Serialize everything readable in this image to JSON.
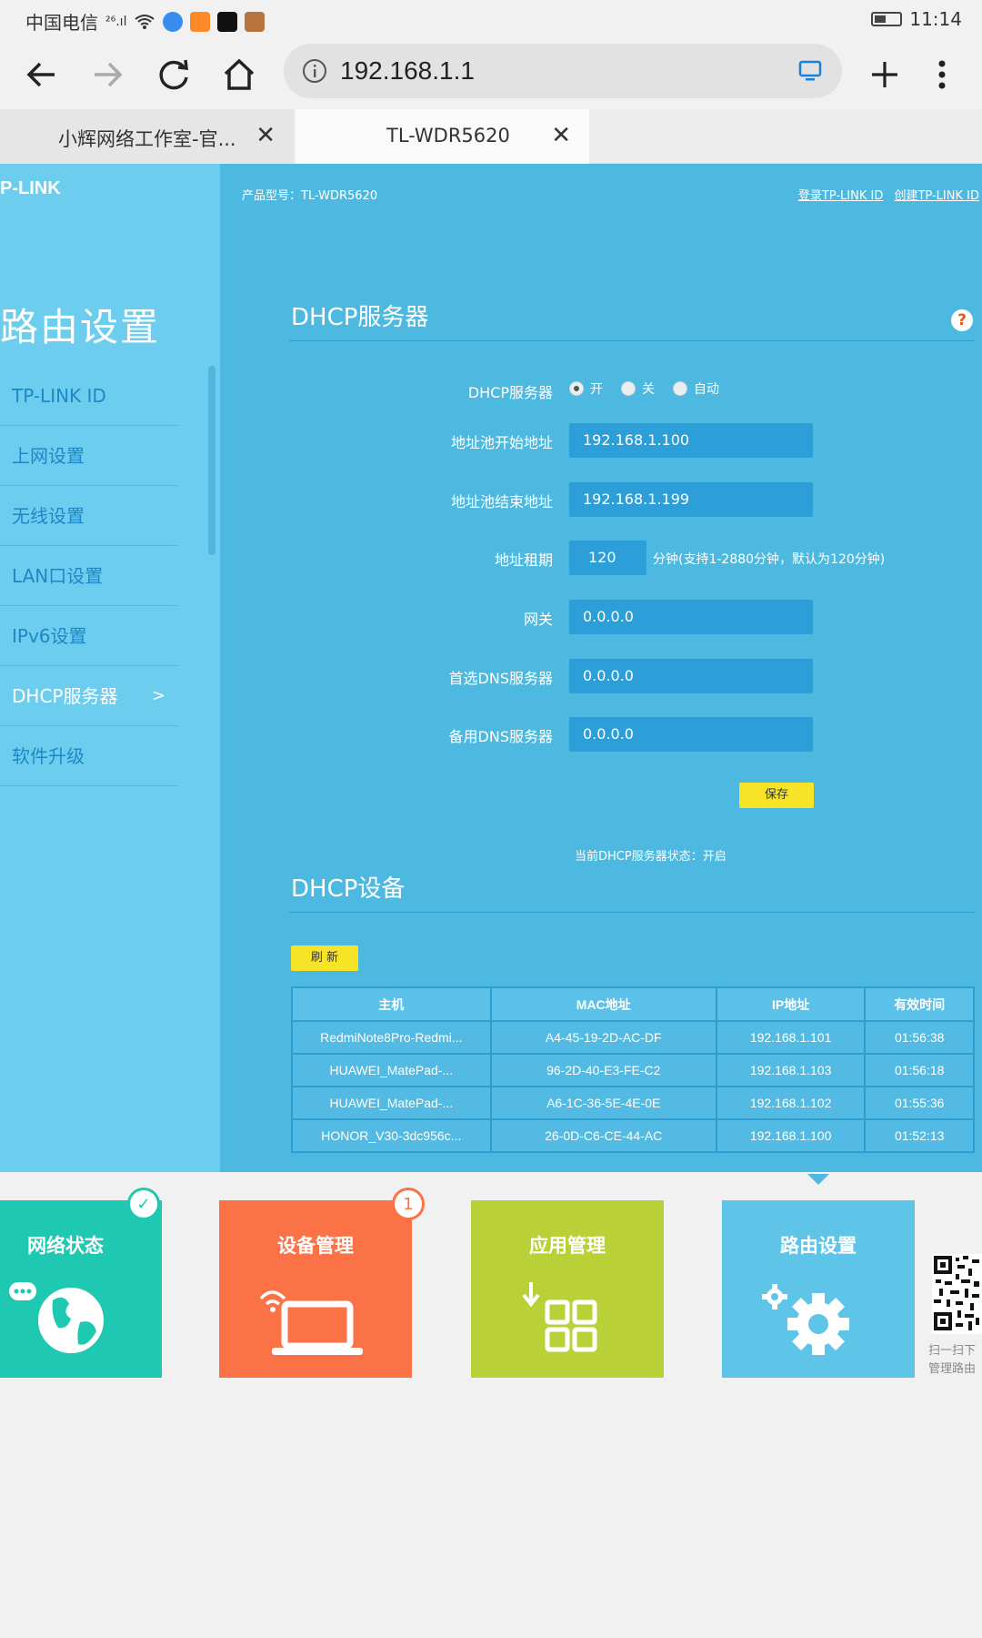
{
  "statusbar": {
    "carrier": "中国电信",
    "signal": "²⁶.ıl",
    "time": "11:14"
  },
  "browser": {
    "url": "192.168.1.1",
    "tabs": [
      {
        "label": "小辉网络工作室-官...",
        "close": "✕"
      },
      {
        "label": "TL-WDR5620",
        "close": "✕"
      }
    ]
  },
  "router": {
    "logo": "P-LINK",
    "product_line": "产品型号：TL-WDR5620",
    "links": {
      "login": "登录TP-LINK ID",
      "create": "创建TP-LINK ID"
    },
    "sidebar_title": "路由设置",
    "nav": [
      {
        "label": "TP-LINK ID"
      },
      {
        "label": "上网设置"
      },
      {
        "label": "无线设置"
      },
      {
        "label": "LAN口设置"
      },
      {
        "label": "IPv6设置"
      },
      {
        "label": "DHCP服务器",
        "arrow": ">"
      },
      {
        "label": "软件升级"
      }
    ],
    "help_icon": "?",
    "dhcp": {
      "title": "DHCP服务器",
      "server_label": "DHCP服务器",
      "options": [
        "开",
        "关",
        "自动"
      ],
      "selected": "开",
      "pool_start_label": "地址池开始地址",
      "pool_start": "192.168.1.100",
      "pool_end_label": "地址池结束地址",
      "pool_end": "192.168.1.199",
      "lease_label": "地址租期",
      "lease": "120",
      "lease_hint": "分钟(支持1-2880分钟，默认为120分钟)",
      "gateway_label": "网关",
      "gateway": "0.0.0.0",
      "dns1_label": "首选DNS服务器",
      "dns1": "0.0.0.0",
      "dns2_label": "备用DNS服务器",
      "dns2": "0.0.0.0",
      "save": "保存",
      "status": "当前DHCP服务器状态：开启"
    },
    "devices": {
      "title": "DHCP设备",
      "refresh": "刷 新",
      "columns": [
        "主机",
        "MAC地址",
        "IP地址",
        "有效时间"
      ],
      "rows": [
        [
          "RedmiNote8Pro-Redmi...",
          "A4-45-19-2D-AC-DF",
          "192.168.1.101",
          "01:56:38"
        ],
        [
          "HUAWEI_MatePad-...",
          "96-2D-40-E3-FE-C2",
          "192.168.1.103",
          "01:56:18"
        ],
        [
          "HUAWEI_MatePad-...",
          "A6-1C-36-5E-4E-0E",
          "192.168.1.102",
          "01:55:36"
        ],
        [
          "HONOR_V30-3dc956c...",
          "26-0D-C6-CE-44-AC",
          "192.168.1.100",
          "01:52:13"
        ]
      ]
    }
  },
  "bottom_nav": {
    "cards": [
      {
        "title": "网络状态",
        "color": "#1fc8b1",
        "badge": "✓"
      },
      {
        "title": "设备管理",
        "color": "#fb7246",
        "badge": "1"
      },
      {
        "title": "应用管理",
        "color": "#b9d136"
      },
      {
        "title": "路由设置",
        "color": "#5fc5e8"
      }
    ],
    "qr_text_1": "扫一扫下",
    "qr_text_2": "管理路由"
  }
}
